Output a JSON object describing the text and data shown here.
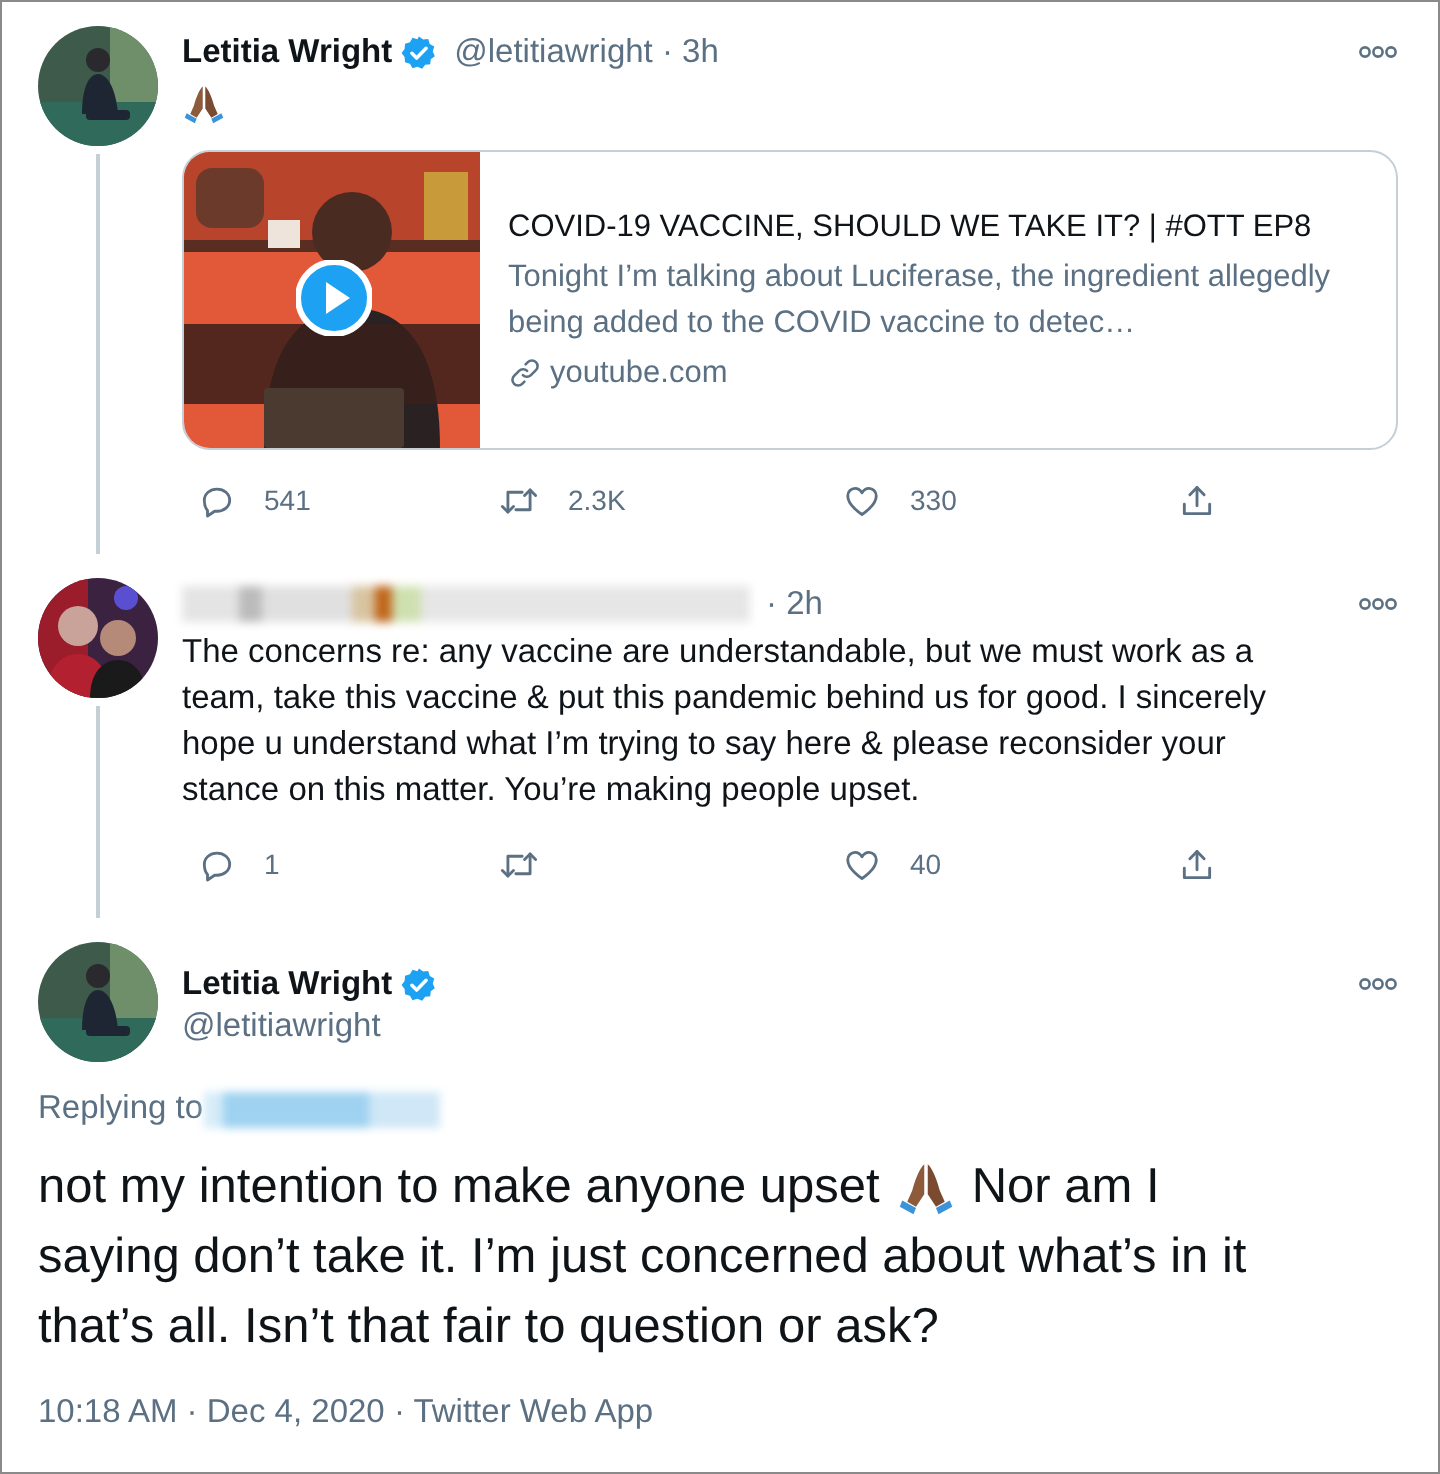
{
  "tweets": [
    {
      "kind": "thread",
      "author": {
        "name": "Letitia Wright",
        "verified": true
      },
      "meta": "@letitiawright · 3h",
      "emoji_body": true,
      "card": {
        "title": "COVID-19 VACCINE, SHOULD WE TAKE IT? | #OTT EP8",
        "description": "Tonight I’m talking about Luciferase, the ingredient allegedly being added to the COVID vaccine to detec…",
        "domain": "youtube.com"
      },
      "actions": [
        {
          "kind": "reply",
          "count": "541"
        },
        {
          "kind": "retweet",
          "count": "2.3K"
        },
        {
          "kind": "like",
          "count": "330"
        },
        {
          "kind": "share"
        }
      ]
    },
    {
      "kind": "reply",
      "author": {
        "name_hidden": true
      },
      "meta": "· 2h",
      "text": "The concerns re: any vaccine are understandable, but we must work as a team, take this vaccine & put this pandemic behind us for good. I sincerely hope u understand what I’m trying to say here & please reconsider your stance on this matter. You’re making people upset.",
      "actions": [
        {
          "kind": "reply",
          "count": "1"
        },
        {
          "kind": "retweet"
        },
        {
          "kind": "like",
          "count": "40"
        },
        {
          "kind": "share"
        }
      ]
    },
    {
      "kind": "focused",
      "author": {
        "name": "Letitia Wright",
        "verified": true
      },
      "meta": "@letitiawright",
      "replying_to": "Replying to",
      "text_parts": [
        "not my intention to make anyone upset",
        "Nor am I",
        "saying don’t take it. I’m just concerned about what’s in it that’s all. Isn’t that fair to question or ask?"
      ],
      "footer": "10:18 AM · Dec 4, 2020 · Twitter Web App"
    }
  ]
}
